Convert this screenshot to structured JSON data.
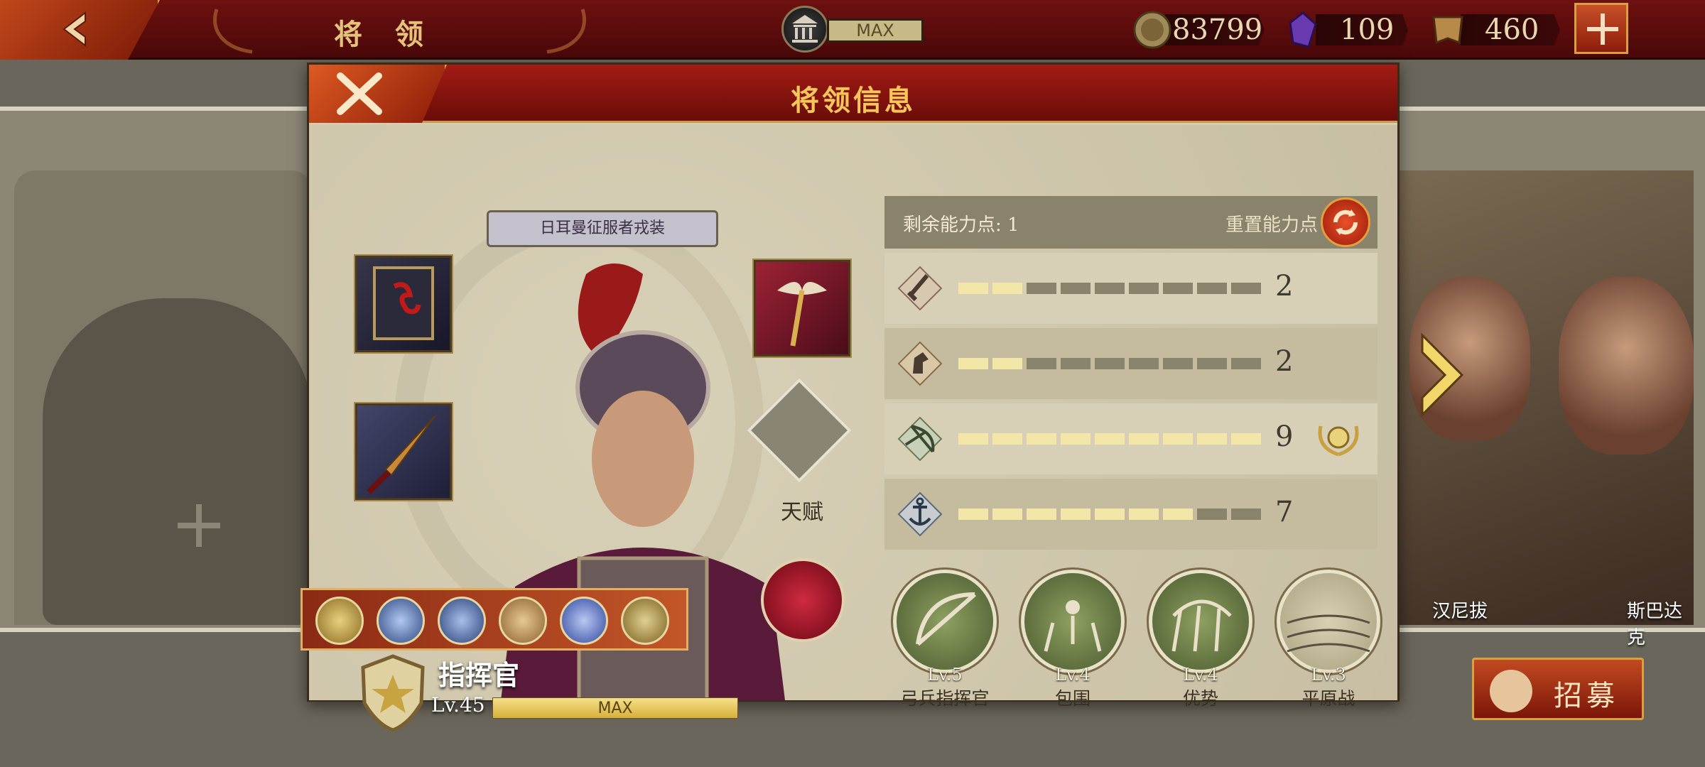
{
  "topbar": {
    "title": "将 领",
    "bank_label": "MAX",
    "resources": [
      {
        "icon": "gold-coin-icon",
        "value": "83799"
      },
      {
        "icon": "purple-gem-icon",
        "value": "109"
      },
      {
        "icon": "spqr-banner-icon",
        "value": "460"
      }
    ]
  },
  "modal": {
    "title": "将领信息",
    "outfit_label": "日耳曼征服者戎装",
    "talent_label": "天赋",
    "rank_name": "指挥官",
    "level": "Lv.45",
    "level_bar_label": "MAX",
    "level_progress": 1.0,
    "stats_header": {
      "remaining_points": "剩余能力点: 1",
      "reset_label": "重置能力点"
    },
    "stats": [
      {
        "icon": "sword-icon",
        "filled": 2,
        "total": 9,
        "value": "2"
      },
      {
        "icon": "horse-icon",
        "filled": 2,
        "total": 9,
        "value": "2"
      },
      {
        "icon": "bow-icon",
        "filled": 9,
        "total": 9,
        "value": "9",
        "maxed": true
      },
      {
        "icon": "anchor-icon",
        "filled": 7,
        "total": 9,
        "value": "7"
      }
    ],
    "skills": [
      {
        "level": "Lv.5",
        "name": "弓兵指挥官",
        "icon": "bow-skill-icon"
      },
      {
        "level": "Lv.4",
        "name": "包围",
        "icon": "encircle-skill-icon"
      },
      {
        "level": "Lv.4",
        "name": "优势",
        "icon": "archers-skill-icon"
      },
      {
        "level": "Lv.3",
        "name": "平原战",
        "icon": "plains-skill-icon"
      }
    ]
  },
  "side_cards": {
    "left_name": "汉尼拔",
    "right_name": "斯巴达克"
  },
  "recruit_label": "招募",
  "colors": {
    "accent_red": "#8b1c08",
    "gold": "#f6c65a",
    "panel": "#c5bc9f"
  }
}
